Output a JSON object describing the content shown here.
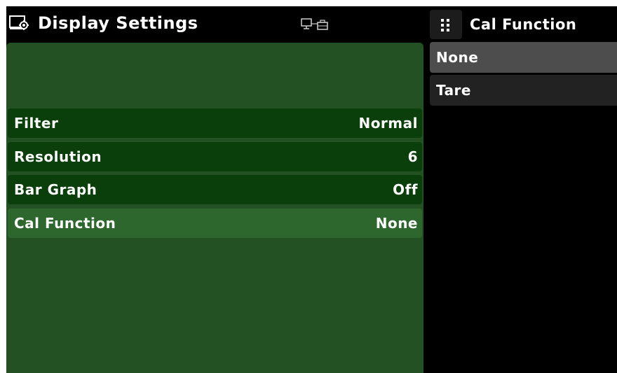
{
  "header": {
    "title": "Display Settings",
    "title_icon": "display-settings-icon",
    "remote_icon": "remote-connection-icon"
  },
  "popup": {
    "menu_icon": "grid-menu-icon",
    "title": "Cal Function",
    "options": [
      {
        "label": "None",
        "selected": true
      },
      {
        "label": "Tare",
        "selected": false
      }
    ]
  },
  "settings": {
    "rows": [
      {
        "label": "Filter",
        "value": "Normal",
        "selected": false
      },
      {
        "label": "Resolution",
        "value": "6",
        "selected": false
      },
      {
        "label": "Bar Graph",
        "value": "Off",
        "selected": false
      },
      {
        "label": "Cal Function",
        "value": "None",
        "selected": true
      }
    ]
  },
  "colors": {
    "panel_green": "#245124",
    "row_green": "#0a3e0a",
    "row_selected_green": "#2e672e",
    "option_bg": "#222222",
    "option_selected_bg": "#4d4d4d",
    "background": "#000000",
    "text": "#ffffff"
  }
}
